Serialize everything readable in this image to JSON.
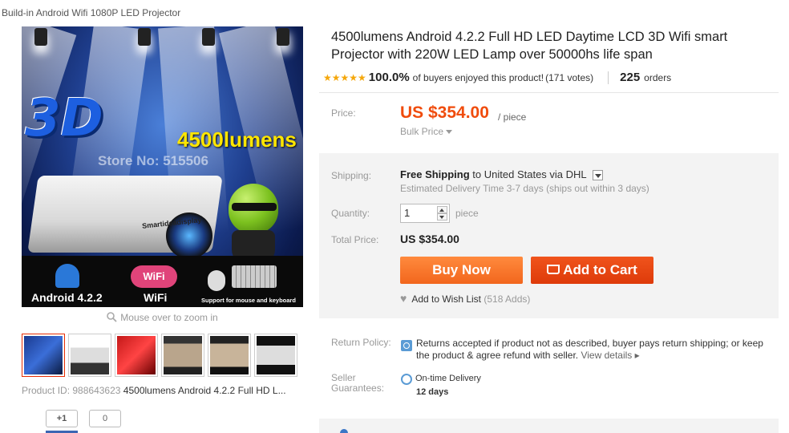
{
  "breadcrumb": "Build-in Android Wifi 1080P LED Projector",
  "gallery": {
    "main_image": {
      "text_3d": "3D",
      "lumens": "4500lumens",
      "store_watermark": "Store No: 515506",
      "brand_label": "Smartideadisplay",
      "features": [
        "Android 4.2.2",
        "WiFi",
        "Support for mouse and keyboard"
      ],
      "wifi_badge": "WiFi"
    },
    "zoom_hint": "Mouse over to zoom in",
    "thumbnails": 6,
    "product_id_label": "Product ID:",
    "product_id": "988643623",
    "product_id_title": "4500lumens Android 4.2.2 Full HD L..."
  },
  "social": {
    "plus_one": "+1",
    "count": "0"
  },
  "product": {
    "title": "4500lumens Android 4.2.2 Full HD LED Daytime LCD 3D Wifi smart Projector with 220W LED Lamp over 50000hs life span",
    "stars": "★★★★★",
    "rating_pct": "100.0%",
    "rating_text": "of buyers enjoyed this product!",
    "votes": "(171 votes)",
    "orders_count": "225",
    "orders_label": "orders"
  },
  "price": {
    "label": "Price:",
    "value": "US $354.00",
    "per": "/ piece",
    "bulk": "Bulk Price"
  },
  "shipping": {
    "label": "Shipping:",
    "method": "Free Shipping",
    "to": "to",
    "destination": "United States via DHL",
    "estimate": "Estimated Delivery Time 3-7 days (ships out within 3 days)"
  },
  "quantity": {
    "label": "Quantity:",
    "value": "1",
    "unit": "piece"
  },
  "total": {
    "label": "Total Price:",
    "value": "US $354.00"
  },
  "actions": {
    "buy_now": "Buy Now",
    "add_to_cart": "Add to Cart",
    "wishlist": "Add to Wish List",
    "wishlist_adds": "(518 Adds)"
  },
  "return_policy": {
    "label": "Return Policy:",
    "text": "Returns accepted if product not as described, buyer pays return shipping; or keep the product & agree refund with seller.",
    "link": "View details ▸"
  },
  "guarantees": {
    "label": "Seller Guarantees:",
    "title": "On-time Delivery",
    "days": "12 days"
  },
  "colors": {
    "accent": "#f04c0d",
    "buy": "#f57224",
    "cart": "#e3410f",
    "star": "#f5a70a"
  }
}
